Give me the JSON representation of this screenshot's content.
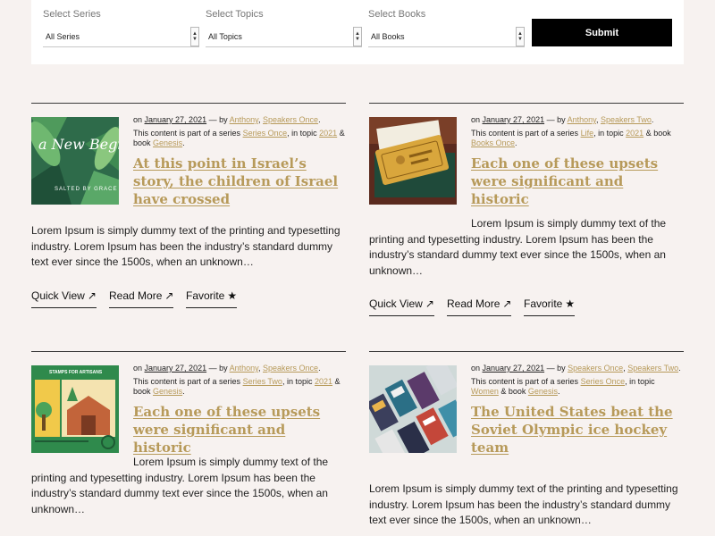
{
  "filters": [
    {
      "label": "Select Series",
      "value": "All Series"
    },
    {
      "label": "Select Topics",
      "value": "All Topics"
    },
    {
      "label": "Select Books",
      "value": "All Books"
    }
  ],
  "submit_label": "Submit",
  "actions": {
    "quick_view": "Quick View",
    "read_more": "Read More",
    "favorite": "Favorite"
  },
  "icons": {
    "arrow": "arrow-up-right-icon",
    "star": "star-icon",
    "dropdown": "dropdown-arrow-icon"
  },
  "colors": {
    "accent": "#c4a466",
    "link": "#b79a5a",
    "page_bg": "#f7f2f0",
    "button": "#000000"
  },
  "meta_text": {
    "on": "on",
    "by": "— by",
    "comma": ",",
    "period": ".",
    "series_prefix": "This content is part of a series",
    "in_topic": ", in topic",
    "and_book": "& book"
  },
  "posts": [
    {
      "date": "January 27, 2021",
      "authors": [
        "Anthony",
        "Speakers Once"
      ],
      "series": "Series Once",
      "topic": "2021",
      "book": "Genesis",
      "title": "At this point in Israel’s story, the children of Israel have crossed",
      "excerpt": "Lorem Ipsum is simply dummy text of the printing and typesetting industry. Lorem Ipsum has been the industry’s standard dummy text ever since the 1500s, when an unknown…",
      "thumb_text": "a New Beginning",
      "thumb_sub": "SALTED BY GRACE"
    },
    {
      "date": "January 27, 2021",
      "authors": [
        "Anthony",
        "Speakers Two"
      ],
      "series": "Life",
      "topic": "2021",
      "book": "Books Once",
      "title": "Each one of these upsets were significant and historic",
      "excerpt": "Lorem Ipsum is simply dummy text of the printing and typesetting industry. Lorem Ipsum has been the industry’s standard dummy text ever since the 1500s, when an unknown…"
    },
    {
      "date": "January 27, 2021",
      "authors": [
        "Anthony",
        "Speakers Once"
      ],
      "series": "Series Two",
      "topic": "2021",
      "book": "Genesis",
      "title": "Each one of these upsets were significant and historic",
      "excerpt": "Lorem Ipsum is simply dummy text of the printing and typesetting industry. Lorem Ipsum has been the industry’s standard dummy text ever since the 1500s, when an unknown…",
      "thumb_text": "STAMPS FOR ARTISANS"
    },
    {
      "date": "January 27, 2021",
      "authors": [
        "Speakers Once",
        "Speakers Two"
      ],
      "series": "Series Once",
      "topic": "Women",
      "book": "Genesis",
      "title": "The United States beat the Soviet Olympic ice hockey team",
      "excerpt": "Lorem Ipsum is simply dummy text of the printing and typesetting industry. Lorem Ipsum has been the industry’s standard dummy text ever since the 1500s, when an unknown…"
    }
  ]
}
